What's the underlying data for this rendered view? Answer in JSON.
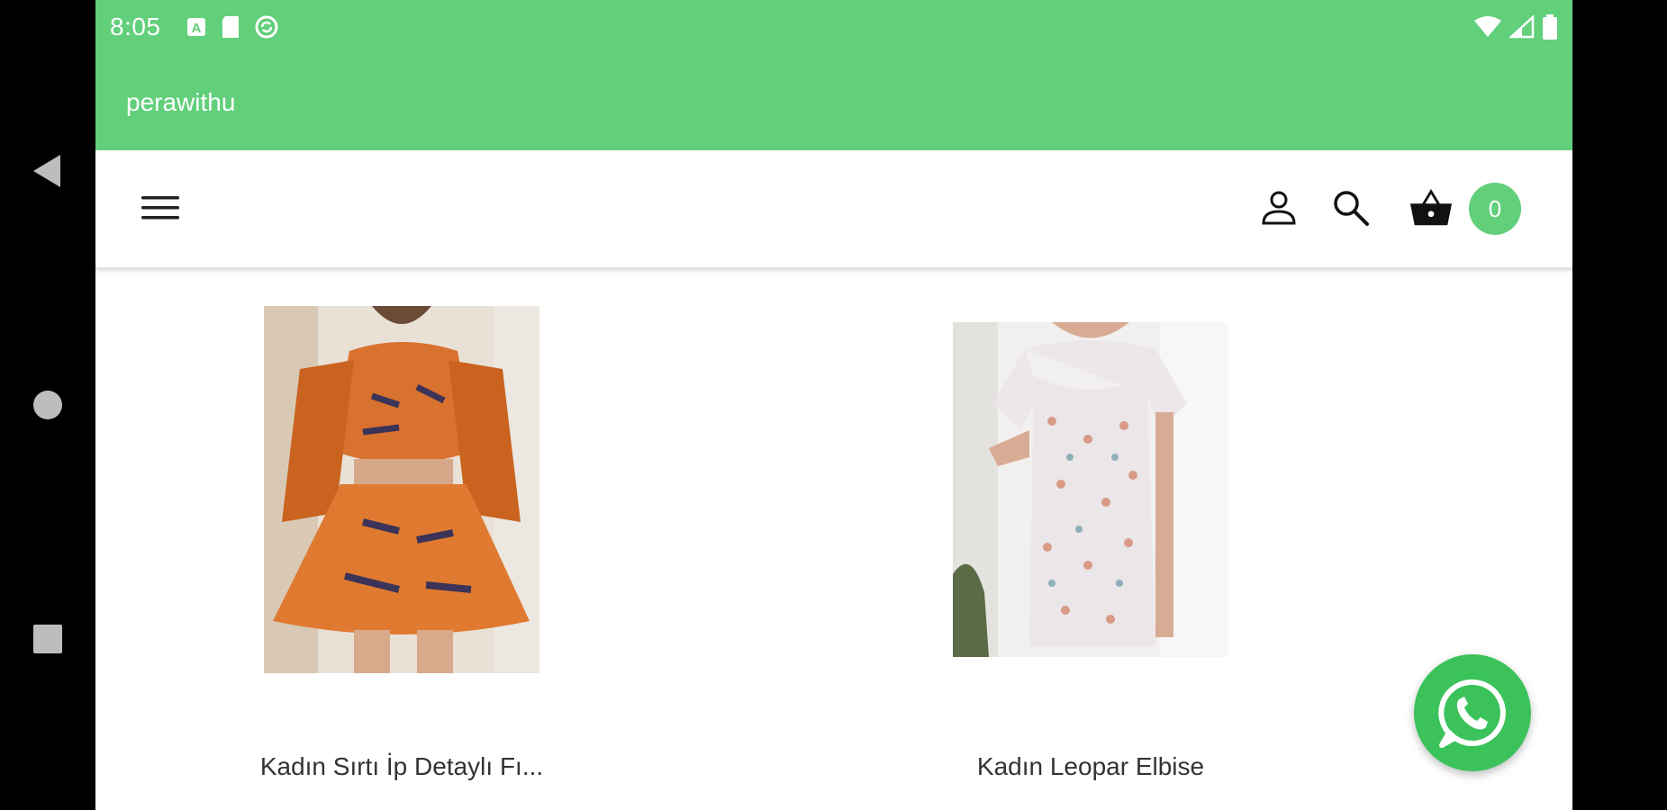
{
  "status_bar": {
    "time": "8:05",
    "left_icons": [
      "text-a-icon",
      "sd-card-icon",
      "sync-icon"
    ],
    "right_icons": [
      "wifi-icon",
      "cell-signal-icon",
      "battery-icon"
    ]
  },
  "app_bar": {
    "title": "perawithu"
  },
  "header": {
    "menu_icon": "hamburger-menu-icon",
    "account_icon": "user-icon",
    "search_icon": "search-icon",
    "cart_icon": "basket-icon",
    "cart_count": "0"
  },
  "products": [
    {
      "name": "Kadın Sırtı İp Detaylı Fı...",
      "image": "orange-floral-two-piece-photo"
    },
    {
      "name": "Kadın Leopar Elbise",
      "image": "floral-mini-dress-photo"
    }
  ],
  "fab": {
    "icon": "whatsapp-icon"
  },
  "colors": {
    "brand_green": "#62cf7b",
    "whatsapp_green": "#3bc25a"
  }
}
